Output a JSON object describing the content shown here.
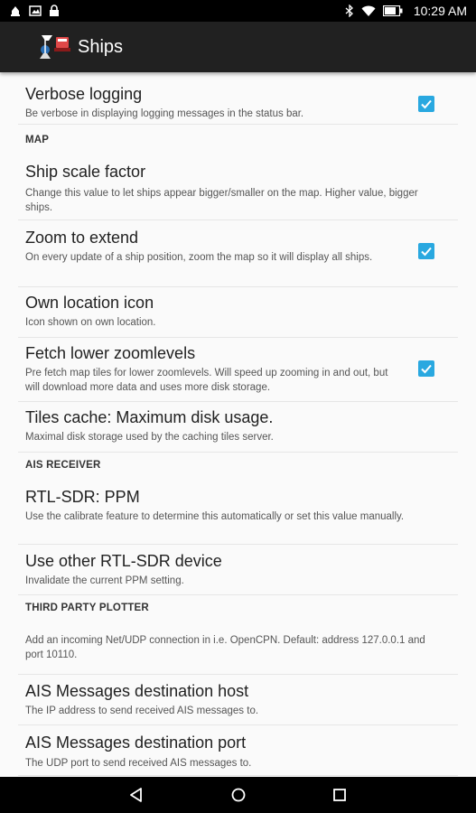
{
  "status_bar": {
    "time": "10:29 AM",
    "left_icons": [
      "notification-icon",
      "screenshot-icon",
      "lock-icon"
    ],
    "right_icons": [
      "bluetooth-icon",
      "wifi-icon",
      "battery-icon"
    ]
  },
  "action_bar": {
    "title": "Ships",
    "icon": "ship-app-icon"
  },
  "preferences": {
    "verbose_logging": {
      "title": "Verbose logging",
      "summary": "Be verbose in displaying logging messages in the status bar.",
      "checked": true
    },
    "map_header": "MAP",
    "ship_scale_factor": {
      "title": "Ship scale factor",
      "summary": "Change this value to let ships appear bigger/smaller on the map. Higher value, bigger ships."
    },
    "zoom_to_extend": {
      "title": "Zoom to extend",
      "summary": "On every update of a ship position, zoom the map so it will display all ships.",
      "checked": true
    },
    "own_location_icon": {
      "title": "Own location icon",
      "summary": "Icon shown on own location."
    },
    "fetch_lower_zoomlevels": {
      "title": "Fetch lower zoomlevels",
      "summary": "Pre fetch map tiles for lower zoomlevels. Will speed up zooming in and out, but will download more data and uses more disk storage.",
      "checked": true
    },
    "tiles_cache": {
      "title": "Tiles cache: Maximum disk usage.",
      "summary": "Maximal disk storage used by the caching tiles server."
    },
    "ais_receiver_header": "AIS RECEIVER",
    "rtl_sdr_ppm": {
      "title": "RTL-SDR: PPM",
      "summary": "Use the calibrate feature to determine this automatically or set this value manually."
    },
    "other_rtl_sdr_device": {
      "title": "Use other RTL-SDR device",
      "summary": "Invalidate the current PPM setting."
    },
    "third_party_plotter_header": "THIRD PARTY PLOTTER",
    "plotter_info": {
      "summary": "Add an incoming Net/UDP connection in i.e. OpenCPN. Default: address 127.0.0.1 and port 10110."
    },
    "ais_destination_host": {
      "title": "AIS Messages destination host",
      "summary": "The IP address to send received AIS messages to."
    },
    "ais_destination_port": {
      "title": "AIS Messages destination port",
      "summary": "The UDP port to send received AIS messages to."
    }
  },
  "nav_bar": {
    "buttons": [
      "back-icon",
      "home-icon",
      "recents-icon"
    ]
  },
  "colors": {
    "accent": "#29a8e0",
    "action_bar": "#212121",
    "background": "#fafafa"
  }
}
